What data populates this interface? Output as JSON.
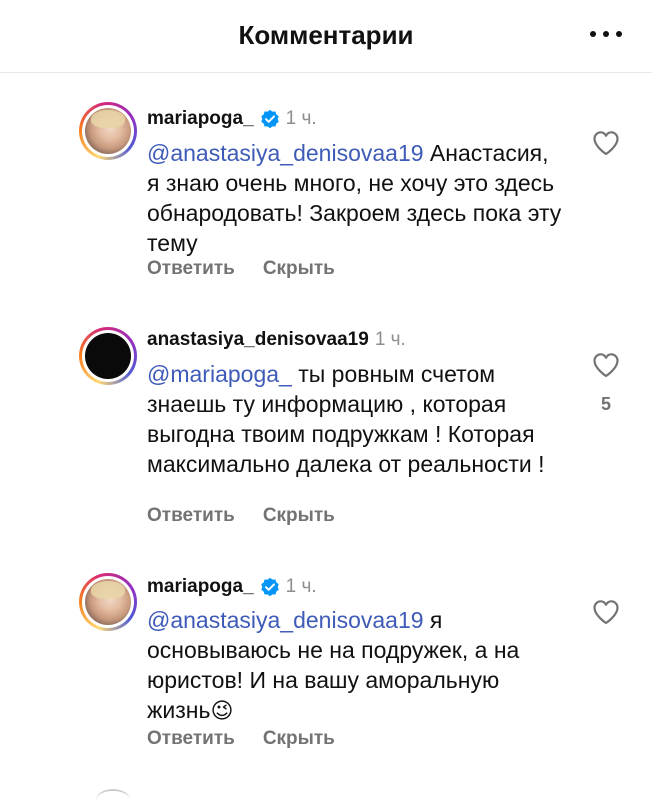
{
  "header": {
    "title": "Комментарии",
    "more_icon": "more-horizontal-icon"
  },
  "comments": [
    {
      "username": "mariapoga_",
      "verified": true,
      "time": "1 ч.",
      "mention": "@anastasiya_denisovaa19",
      "text_line1": " Анастасия,",
      "text_rest": "я знаю очень много, не хочу это здесь обнародовать! Закроем здесь пока эту тему",
      "reply_label": "Ответить",
      "hide_label": "Скрыть",
      "likes": ""
    },
    {
      "username": "anastasiya_denisovaa19",
      "verified": false,
      "time": "1 ч.",
      "mention": "@mariapoga_",
      "text_line1": " ты ровным счетом",
      "text_rest": "знаешь ту информацию , которая выгодна твоим подружкам ! Которая максимально далека от реальности !",
      "reply_label": "Ответить",
      "hide_label": "Скрыть",
      "likes": "5"
    },
    {
      "username": "mariapoga_",
      "verified": true,
      "time": "1 ч.",
      "mention": "@anastasiya_denisovaa19",
      "text_line1": " я",
      "text_rest": "основываюсь не на подружек, а на юристов! И на вашу аморальную жизнь",
      "emoji": "😉",
      "reply_label": "Ответить",
      "hide_label": "Скрыть",
      "likes": ""
    }
  ],
  "colors": {
    "mention": "#3e5bb8",
    "verified": "#0095f6",
    "secondary_text": "#737373"
  }
}
